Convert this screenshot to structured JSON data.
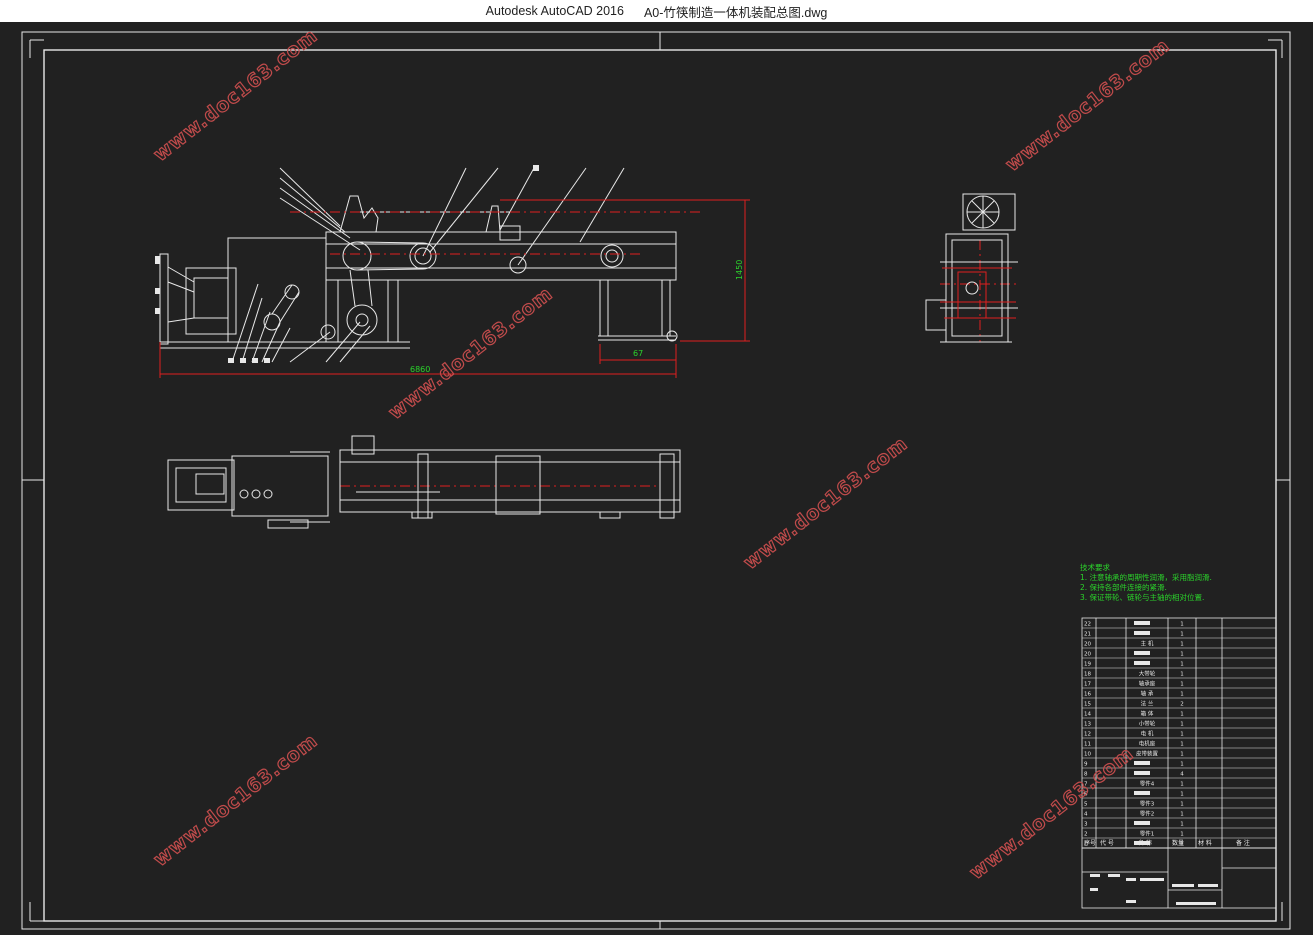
{
  "window": {
    "app_name": "Autodesk AutoCAD 2016",
    "file_name": "A0-竹筷制造一体机装配总图.dwg"
  },
  "drawing": {
    "watermark": "www.doc163.com",
    "dimensions": {
      "overall_length": "6860",
      "height": "1450",
      "offset": "67"
    },
    "tech_requirements": {
      "title": "技术要求",
      "items": [
        "1. 注意轴承的周期性润滑，采用脂润滑.",
        "2. 保持各部件连接的紧滑.",
        "3. 保证带轮、链轮与主轴的相对位置."
      ]
    },
    "bom": {
      "rows": [
        {
          "no": "22",
          "name": "",
          "qty": "1"
        },
        {
          "no": "21",
          "name": "",
          "qty": "1"
        },
        {
          "no": "20",
          "name": "主  机",
          "qty": "1"
        },
        {
          "no": "20",
          "name": "",
          "qty": "1"
        },
        {
          "no": "19",
          "name": "",
          "qty": "1"
        },
        {
          "no": "18",
          "name": "大带轮",
          "qty": "1"
        },
        {
          "no": "17",
          "name": "轴承座",
          "qty": "1"
        },
        {
          "no": "16",
          "name": "轴  承",
          "qty": "1"
        },
        {
          "no": "15",
          "name": "法  兰",
          "qty": "2"
        },
        {
          "no": "14",
          "name": "箱  体",
          "qty": "1"
        },
        {
          "no": "13",
          "name": "小带轮",
          "qty": "1"
        },
        {
          "no": "12",
          "name": "电  机",
          "qty": "1"
        },
        {
          "no": "11",
          "name": "电机座",
          "qty": "1"
        },
        {
          "no": "10",
          "name": "皮带装置",
          "qty": "1"
        },
        {
          "no": "9",
          "name": "",
          "qty": "1"
        },
        {
          "no": "8",
          "name": "",
          "qty": "4"
        },
        {
          "no": "7",
          "name": "零件4",
          "qty": "1"
        },
        {
          "no": "6",
          "name": "",
          "qty": "1"
        },
        {
          "no": "5",
          "name": "零件3",
          "qty": "1"
        },
        {
          "no": "4",
          "name": "零件2",
          "qty": "1"
        },
        {
          "no": "3",
          "name": "",
          "qty": "1"
        },
        {
          "no": "2",
          "name": "零件1",
          "qty": "1"
        },
        {
          "no": "1",
          "name": "",
          "qty": "1"
        }
      ],
      "header": {
        "no": "序号",
        "code": "代  号",
        "name": "名  称",
        "qty": "数量",
        "material": "材  料",
        "remark": "备  注"
      }
    }
  },
  "colors": {
    "background": "#212121",
    "lines": "#e8e8e8",
    "dimension": "#e01e1e",
    "annotation": "#2bd42b",
    "watermark": "#c04b4b"
  }
}
